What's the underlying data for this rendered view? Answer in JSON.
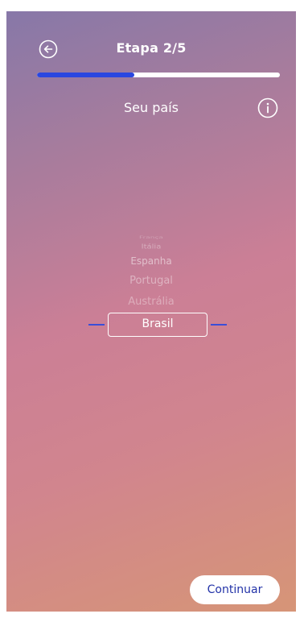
{
  "header": {
    "step_title": "Etapa 2/5"
  },
  "progress": {
    "fraction": 0.4,
    "fill_color": "#2a47e0"
  },
  "section": {
    "title": "Seu país"
  },
  "icons": {
    "back": "arrow-left-circle-icon",
    "info": "info-circle-icon"
  },
  "picker": {
    "options": [
      "França",
      "Itália",
      "Espanha",
      "Portugal",
      "Austrália"
    ],
    "selected": "Brasil",
    "accent_color": "#3a4ed8"
  },
  "footer": {
    "continue_label": "Continuar",
    "continue_text_color": "#2333a8"
  }
}
